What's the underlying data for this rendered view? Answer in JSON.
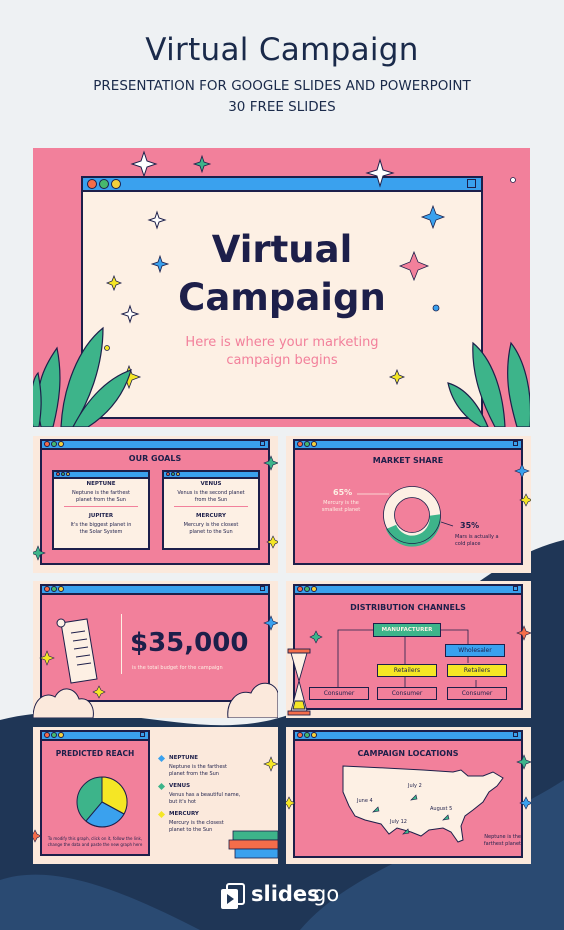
{
  "header": {
    "title": "Virtual Campaign",
    "subtitle": "PRESENTATION FOR GOOGLE SLIDES AND POWERPOINT",
    "slide_count": "30 FREE SLIDES"
  },
  "cover": {
    "title_line1": "Virtual",
    "title_line2": "Campaign",
    "tagline_line1": "Here is where your marketing",
    "tagline_line2": "campaign begins"
  },
  "goals": {
    "title": "OUR GOALS",
    "items": [
      {
        "name": "NEPTUNE",
        "text_line1": "Neptune is the farthest",
        "text_line2": "planet from the Sun"
      },
      {
        "name": "JUPITER",
        "text_line1": "It's the biggest planet in",
        "text_line2": "the Solar System"
      },
      {
        "name": "VENUS",
        "text_line1": "Venus is the second planet",
        "text_line2": "from the Sun"
      },
      {
        "name": "MERCURY",
        "text_line1": "Mercury is the closest",
        "text_line2": "planet to the Sun"
      }
    ]
  },
  "market": {
    "title": "MARKET SHARE",
    "left_pct": "65%",
    "left_line1": "Mercury is the",
    "left_line2": "smallest planet",
    "right_pct": "35%",
    "right_line1": "Mars is actually a",
    "right_line2": "cold place"
  },
  "budget": {
    "amount": "$35,000",
    "caption": "is the total budget for the campaign"
  },
  "distribution": {
    "title": "DISTRIBUTION CHANNELS",
    "manufacturer": "MANUFACTURER",
    "wholesaler": "Wholesaler",
    "retailers": "Retailers",
    "consumer": "Consumer"
  },
  "reach": {
    "title": "PREDICTED REACH",
    "items": [
      {
        "name": "NEPTUNE",
        "text_line1": "Neptune is the farthest",
        "text_line2": "planet from the Sun"
      },
      {
        "name": "VENUS",
        "text_line1": "Venus has a beautiful name,",
        "text_line2": "but it's hot"
      },
      {
        "name": "MERCURY",
        "text_line1": "Mercury is the closest",
        "text_line2": "planet to the Sun"
      }
    ],
    "note_line1": "To modify this graph, click on it, follow the link,",
    "note_line2": "change the data and paste the new graph here"
  },
  "locations": {
    "title": "CAMPAIGN LOCATIONS",
    "labels": [
      "July 2",
      "June 4",
      "August 5",
      "July 12"
    ],
    "note_line1": "Neptune is the",
    "note_line2": "farthest planet"
  },
  "brand": {
    "name_part1": "slides",
    "name_part2": "go"
  },
  "colors": {
    "navy": "#1d1f4a",
    "pink": "#f2809b",
    "cream": "#fdf0e4",
    "blue": "#3aa1ee",
    "green": "#3db48a",
    "yellow": "#f5e625"
  }
}
